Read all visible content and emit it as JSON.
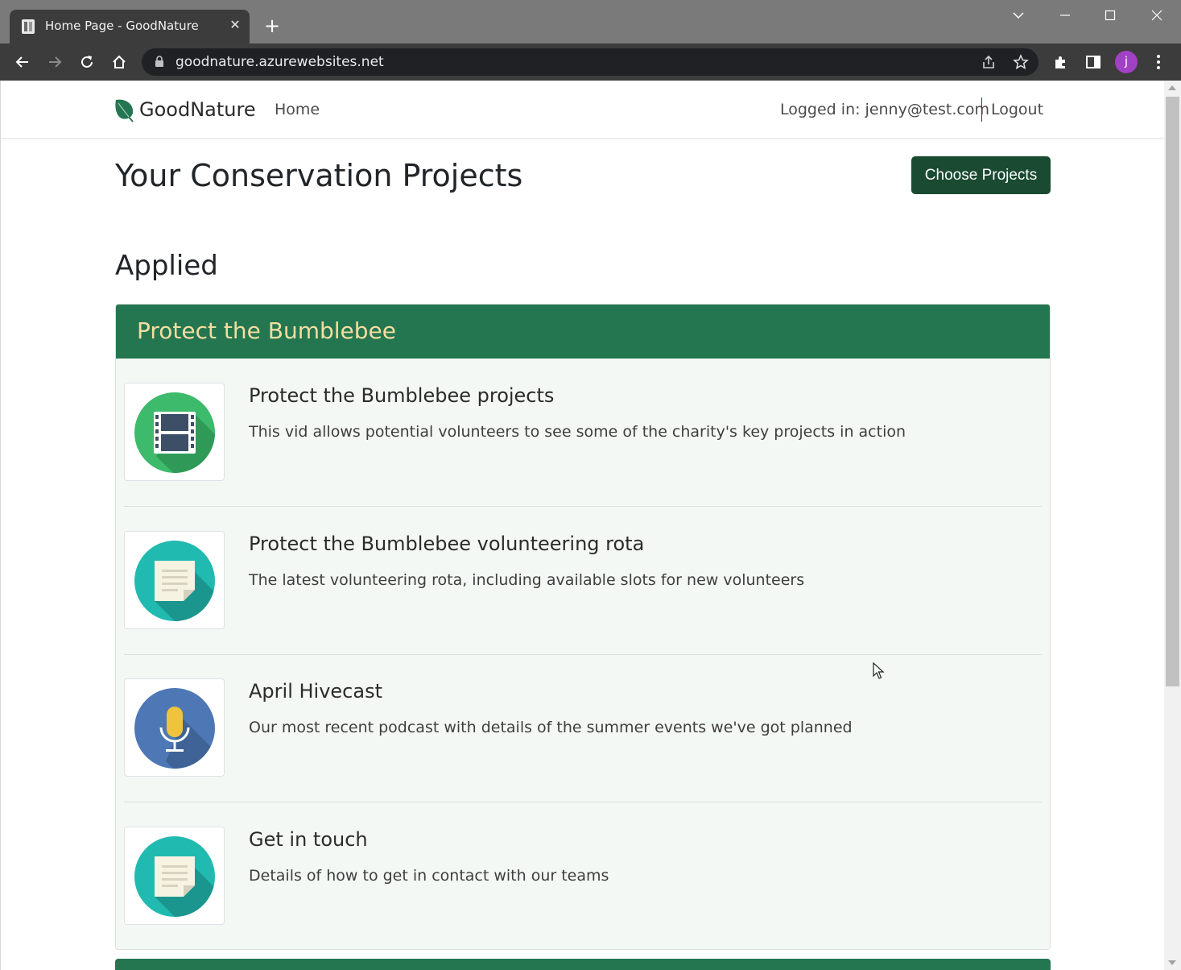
{
  "browser": {
    "tab_title": "Home Page - GoodNature",
    "url": "goodnature.azurewebsites.net",
    "profile_initial": "j"
  },
  "navbar": {
    "brand": "GoodNature",
    "home": "Home",
    "logged_in": "Logged in: jenny@test.com",
    "logout": "Logout"
  },
  "page": {
    "title": "Your Conservation Projects",
    "choose_button": "Choose Projects",
    "section_title": "Applied"
  },
  "card": {
    "title": "Protect the Bumblebee",
    "items": [
      {
        "title": "Protect the Bumblebee projects",
        "description": "This vid allows potential volunteers to see some of the charity's key projects in action",
        "icon": "video-icon"
      },
      {
        "title": "Protect the Bumblebee volunteering rota",
        "description": "The latest volunteering rota, including available slots for new volunteers",
        "icon": "document-icon"
      },
      {
        "title": "April Hivecast",
        "description": "Our most recent podcast with details of the summer events we've got planned",
        "icon": "microphone-icon"
      },
      {
        "title": "Get in touch",
        "description": "Details of how to get in contact with our teams",
        "icon": "document-icon"
      }
    ]
  },
  "colors": {
    "brand_green": "#247650",
    "dark_green": "#1a4a31",
    "card_title": "#f3dea0",
    "card_bg": "#f3f8f5"
  }
}
